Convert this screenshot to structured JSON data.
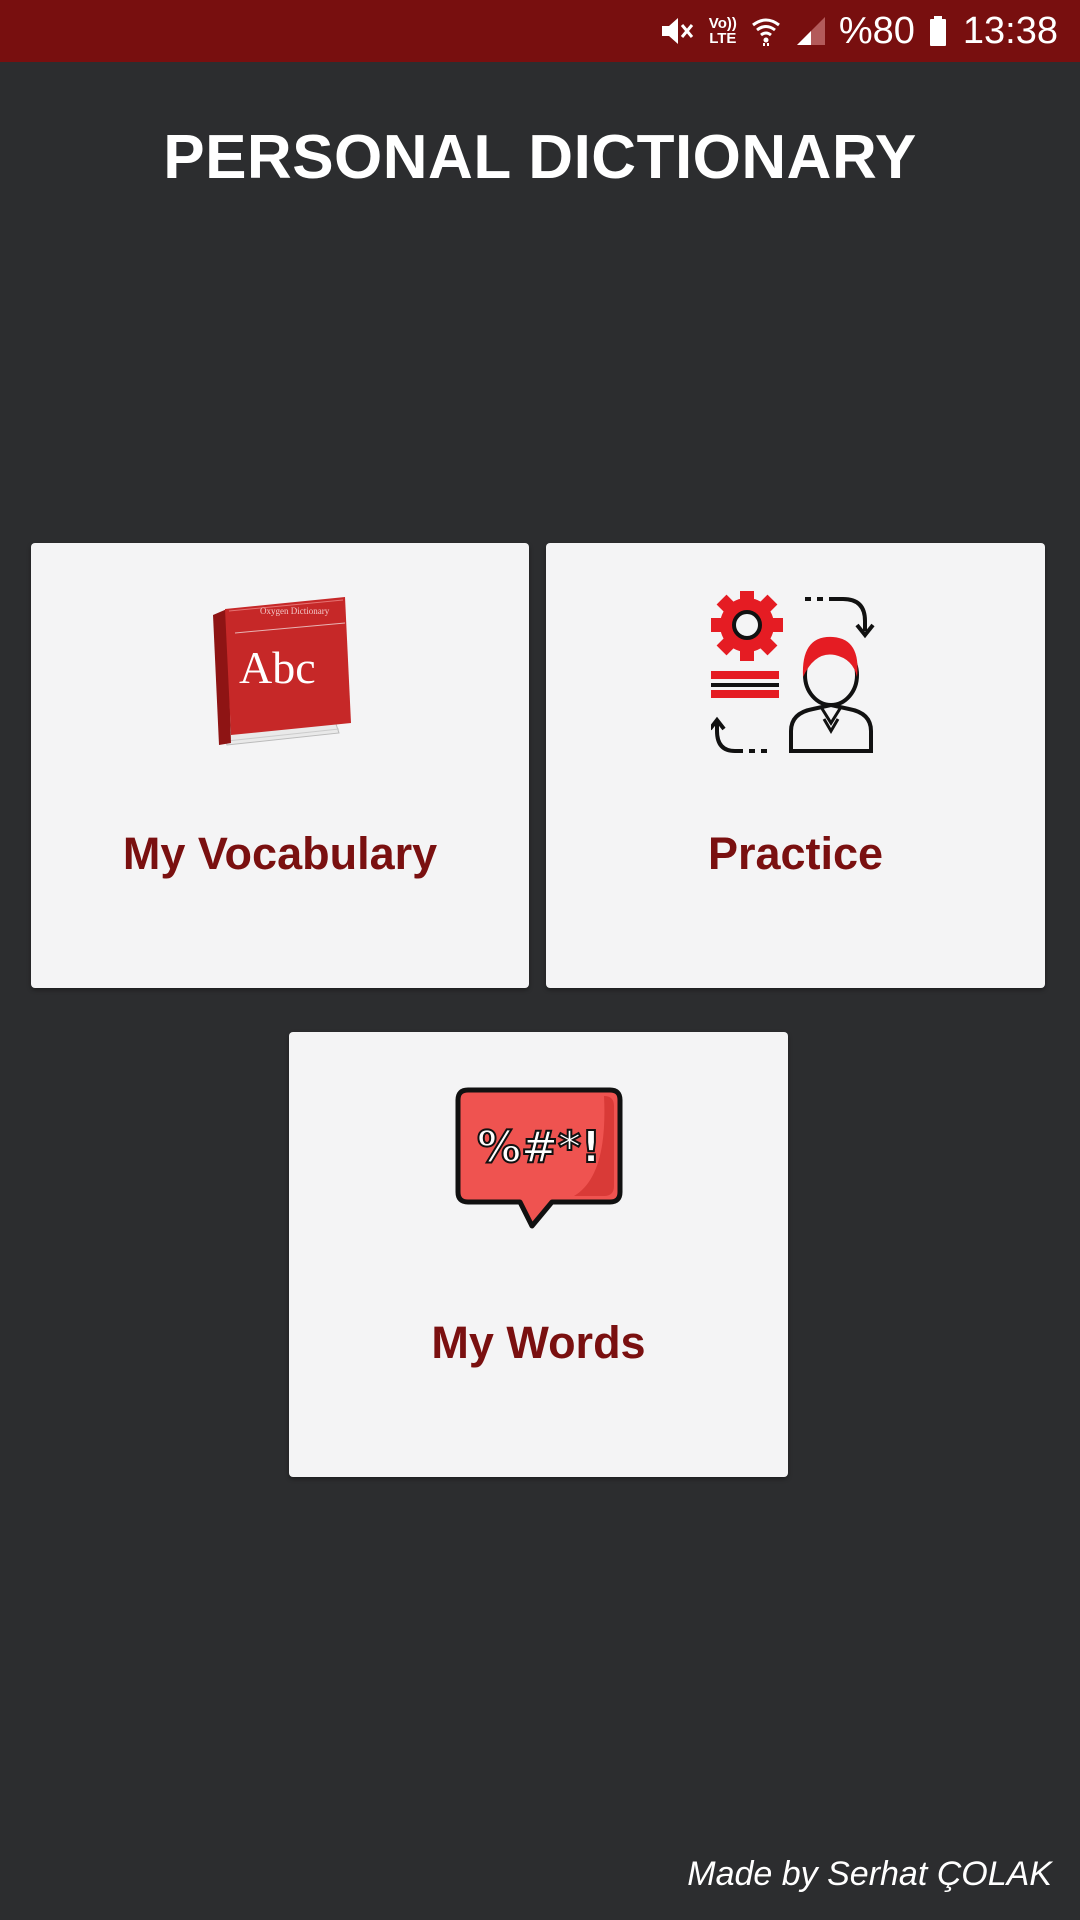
{
  "status_bar": {
    "lte_top": "Vo))",
    "lte_bottom": "LTE",
    "battery": "%80",
    "time": "13:38",
    "icons": [
      "mute-icon",
      "volte-icon",
      "wifi-icon",
      "signal-icon",
      "battery-icon"
    ]
  },
  "header": {
    "title": "PERSONAL DICTIONARY"
  },
  "cards": [
    {
      "label": "My Vocabulary",
      "icon": "dictionary-book-icon",
      "book_text": "Abc",
      "book_subtitle": "Oxygen Dictionary"
    },
    {
      "label": "Practice",
      "icon": "practice-person-gear-icon"
    },
    {
      "label": "My Words",
      "icon": "speech-bubble-symbols-icon",
      "bubble_text": "%#*!"
    }
  ],
  "footer": {
    "credit": "Made by Serhat ÇOLAK"
  },
  "colors": {
    "status_bar_bg": "#780f0f",
    "background": "#2c2d2f",
    "card_bg": "#f4f4f5",
    "accent_text": "#7a1010",
    "icon_red": "#e53935"
  }
}
